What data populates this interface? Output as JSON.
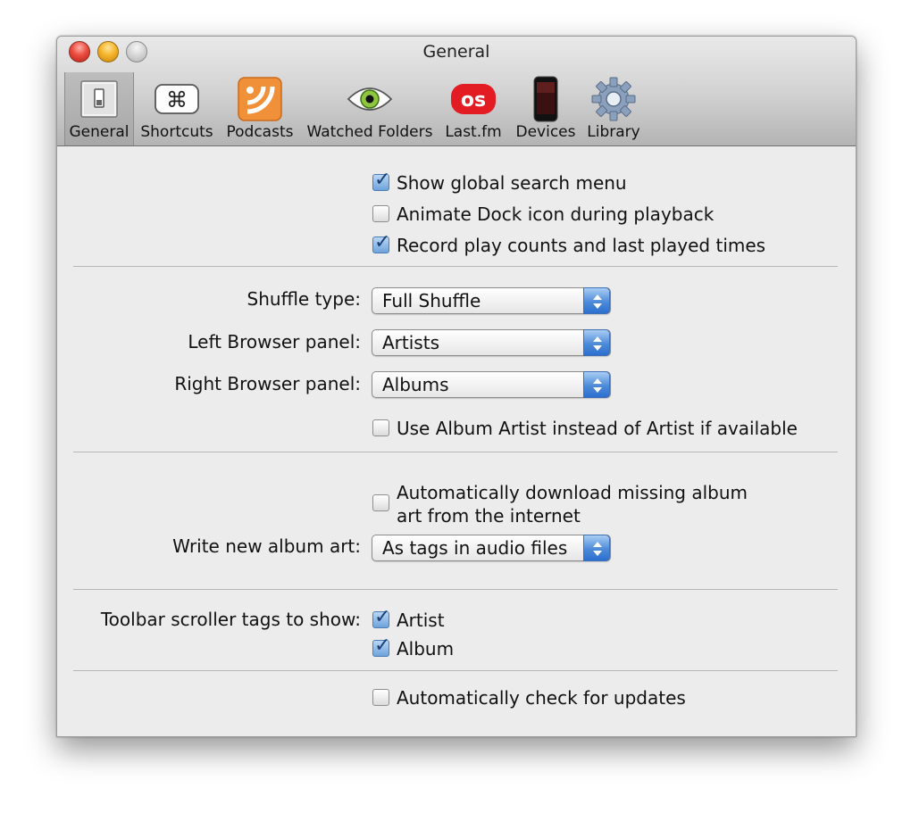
{
  "window": {
    "title": "General"
  },
  "toolbar": {
    "items": [
      {
        "label": "General",
        "icon": "switch-icon",
        "selected": true
      },
      {
        "label": "Shortcuts",
        "icon": "command-key-icon"
      },
      {
        "label": "Podcasts",
        "icon": "podcast-icon"
      },
      {
        "label": "Watched Folders",
        "icon": "eye-icon"
      },
      {
        "label": "Last.fm",
        "icon": "lastfm-icon"
      },
      {
        "label": "Devices",
        "icon": "phone-icon"
      },
      {
        "label": "Library",
        "icon": "gear-icon"
      }
    ]
  },
  "general": {
    "show_global_search": {
      "label": "Show global search menu",
      "checked": true
    },
    "animate_dock": {
      "label": "Animate Dock icon during playback",
      "checked": false
    },
    "record_play_counts": {
      "label": "Record play counts and last played times",
      "checked": true
    }
  },
  "browser": {
    "shuffle_label": "Shuffle type:",
    "shuffle_value": "Full Shuffle",
    "left_label": "Left Browser panel:",
    "left_value": "Artists",
    "right_label": "Right Browser panel:",
    "right_value": "Albums",
    "use_album_artist": {
      "label": "Use Album Artist instead of Artist if available",
      "checked": false
    }
  },
  "album_art": {
    "auto_download": {
      "label_line1": "Automatically download missing album",
      "label_line2": "art from the internet",
      "checked": false
    },
    "write_label": "Write new album art:",
    "write_value": "As tags in audio files"
  },
  "scroller": {
    "label": "Toolbar scroller tags to show:",
    "artist": {
      "label": "Artist",
      "checked": true
    },
    "album": {
      "label": "Album",
      "checked": true
    }
  },
  "updates": {
    "auto_check": {
      "label": "Automatically check for updates",
      "checked": false
    }
  },
  "colors": {
    "accent": "#4c8bd9",
    "close": "#ec4c3f",
    "minimize": "#f5b52b",
    "lastfm": "#e31b23",
    "podcast": "#f0913a"
  }
}
